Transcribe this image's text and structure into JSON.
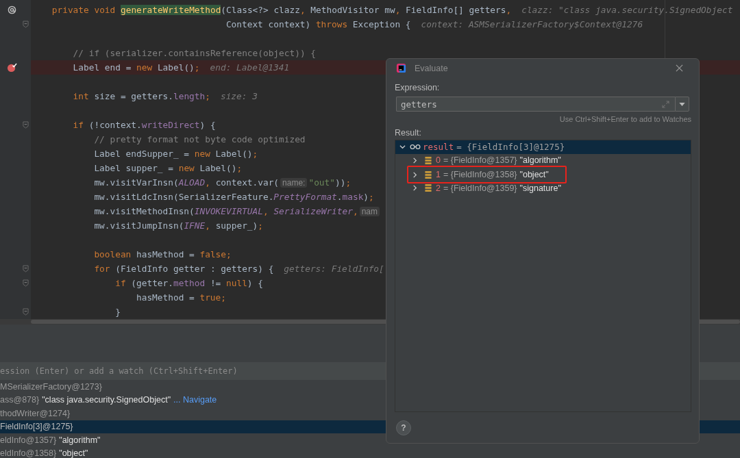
{
  "editor": {
    "lines": [
      {
        "gutter": {
          "kind": "override"
        },
        "breakpoint": false,
        "segs": [
          {
            "kind": "code",
            "tokens": [
              {
                "kind": "kw",
                "t": "    private void "
              },
              {
                "kind": "hl",
                "t": "generateWriteMethod"
              },
              {
                "kind": "id",
                "t": "(Class<?> clazz"
              },
              {
                "kind": "kw",
                "t": ", "
              },
              {
                "kind": "id",
                "t": "MethodVisitor mw"
              },
              {
                "kind": "kw",
                "t": ", "
              },
              {
                "kind": "id",
                "t": "FieldInfo[] getters"
              },
              {
                "kind": "kw",
                "t": ","
              }
            ]
          },
          {
            "kind": "hint",
            "text": "clazz: \"class java.security.SignedObject"
          }
        ]
      },
      {
        "gutter": {
          "kind": "fold"
        },
        "breakpoint": false,
        "segs": [
          {
            "kind": "code",
            "tokens": [
              {
                "kind": "id",
                "t": "                                     Context context) "
              },
              {
                "kind": "kw",
                "t": "throws"
              },
              {
                "kind": "id",
                "t": " Exception {"
              }
            ]
          },
          {
            "kind": "hint",
            "text": "context: ASMSerializerFactory$Context@1276"
          }
        ]
      },
      {
        "breakpoint": false
      },
      {
        "breakpoint": false,
        "segs": [
          {
            "kind": "code",
            "tokens": [
              {
                "kind": "cm",
                "t": "        // if (serializer.containsReference(object)) {"
              }
            ]
          }
        ]
      },
      {
        "gutter": {
          "kind": "breakpoint"
        },
        "breakpoint": true,
        "segs": [
          {
            "kind": "code",
            "tokens": [
              {
                "kind": "id",
                "t": "        Label end = "
              },
              {
                "kind": "kw",
                "t": "new"
              },
              {
                "kind": "id",
                "t": " Label()"
              },
              {
                "kind": "kw",
                "t": ";"
              }
            ]
          },
          {
            "kind": "hint",
            "text": "end: Label@1341"
          }
        ]
      },
      {
        "breakpoint": false
      },
      {
        "breakpoint": false,
        "segs": [
          {
            "kind": "code",
            "tokens": [
              {
                "kind": "kw",
                "t": "        int"
              },
              {
                "kind": "id",
                "t": " size = getters."
              },
              {
                "kind": "fd",
                "t": "length"
              },
              {
                "kind": "kw",
                "t": ";"
              }
            ]
          },
          {
            "kind": "hint",
            "text": "size: 3"
          }
        ]
      },
      {
        "breakpoint": false
      },
      {
        "gutter": {
          "kind": "fold"
        },
        "breakpoint": false,
        "segs": [
          {
            "kind": "code",
            "tokens": [
              {
                "kind": "kw",
                "t": "        if"
              },
              {
                "kind": "id",
                "t": " (!context."
              },
              {
                "kind": "fd",
                "t": "writeDirect"
              },
              {
                "kind": "id",
                "t": ") {"
              }
            ]
          }
        ]
      },
      {
        "breakpoint": false,
        "segs": [
          {
            "kind": "code",
            "tokens": [
              {
                "kind": "cm",
                "t": "            // pretty format not byte code optimized"
              }
            ]
          }
        ]
      },
      {
        "breakpoint": false,
        "segs": [
          {
            "kind": "code",
            "tokens": [
              {
                "kind": "id",
                "t": "            Label endSupper_ = "
              },
              {
                "kind": "kw",
                "t": "new"
              },
              {
                "kind": "id",
                "t": " Label()"
              },
              {
                "kind": "kw",
                "t": ";"
              }
            ]
          }
        ]
      },
      {
        "breakpoint": false,
        "segs": [
          {
            "kind": "code",
            "tokens": [
              {
                "kind": "id",
                "t": "            Label supper_ = "
              },
              {
                "kind": "kw",
                "t": "new"
              },
              {
                "kind": "id",
                "t": " Label()"
              },
              {
                "kind": "kw",
                "t": ";"
              }
            ]
          }
        ]
      },
      {
        "breakpoint": false,
        "segs": [
          {
            "kind": "code",
            "tokens": [
              {
                "kind": "id",
                "t": "            mw.visitVarInsn("
              },
              {
                "kind": "cst",
                "t": "ALOAD"
              },
              {
                "kind": "kw",
                "t": ", "
              },
              {
                "kind": "id",
                "t": "context.var("
              }
            ]
          },
          {
            "kind": "param",
            "text": "name:"
          },
          {
            "kind": "code",
            "tokens": [
              {
                "kind": "str",
                "t": "\"out\""
              },
              {
                "kind": "id",
                "t": "))"
              },
              {
                "kind": "kw",
                "t": ";"
              }
            ]
          }
        ]
      },
      {
        "breakpoint": false,
        "segs": [
          {
            "kind": "code",
            "tokens": [
              {
                "kind": "id",
                "t": "            mw.visitLdcInsn(SerializerFeature."
              },
              {
                "kind": "cst",
                "t": "PrettyFormat"
              },
              {
                "kind": "id",
                "t": "."
              },
              {
                "kind": "fd",
                "t": "mask"
              },
              {
                "kind": "id",
                "t": ")"
              },
              {
                "kind": "kw",
                "t": ";"
              }
            ]
          }
        ]
      },
      {
        "breakpoint": false,
        "segs": [
          {
            "kind": "code",
            "tokens": [
              {
                "kind": "id",
                "t": "            mw.visitMethodInsn("
              },
              {
                "kind": "cst",
                "t": "INVOKEVIRTUAL"
              },
              {
                "kind": "kw",
                "t": ", "
              },
              {
                "kind": "cst",
                "t": "SerializeWriter"
              },
              {
                "kind": "kw",
                "t": ","
              }
            ]
          },
          {
            "kind": "param",
            "text": "nam"
          }
        ]
      },
      {
        "breakpoint": false,
        "segs": [
          {
            "kind": "code",
            "tokens": [
              {
                "kind": "id",
                "t": "            mw.visitJumpInsn("
              },
              {
                "kind": "cst",
                "t": "IFNE"
              },
              {
                "kind": "kw",
                "t": ", "
              },
              {
                "kind": "id",
                "t": "supper_)"
              },
              {
                "kind": "kw",
                "t": ";"
              }
            ]
          }
        ]
      },
      {
        "breakpoint": false
      },
      {
        "breakpoint": false,
        "segs": [
          {
            "kind": "code",
            "tokens": [
              {
                "kind": "kw",
                "t": "            boolean"
              },
              {
                "kind": "id",
                "t": " hasMethod = "
              },
              {
                "kind": "kw",
                "t": "false;"
              }
            ]
          }
        ]
      },
      {
        "gutter": {
          "kind": "fold"
        },
        "breakpoint": false,
        "segs": [
          {
            "kind": "code",
            "tokens": [
              {
                "kind": "kw",
                "t": "            for"
              },
              {
                "kind": "id",
                "t": " (FieldInfo getter : getters) {"
              }
            ]
          },
          {
            "kind": "hint",
            "text": "getters: FieldInfo["
          }
        ]
      },
      {
        "gutter": {
          "kind": "fold"
        },
        "breakpoint": false,
        "segs": [
          {
            "kind": "code",
            "tokens": [
              {
                "kind": "kw",
                "t": "                if"
              },
              {
                "kind": "id",
                "t": " (getter."
              },
              {
                "kind": "fd",
                "t": "method"
              },
              {
                "kind": "id",
                "t": " != "
              },
              {
                "kind": "kw",
                "t": "null"
              },
              {
                "kind": "id",
                "t": ") {"
              }
            ]
          }
        ]
      },
      {
        "breakpoint": false,
        "segs": [
          {
            "kind": "code",
            "tokens": [
              {
                "kind": "id",
                "t": "                    hasMethod = "
              },
              {
                "kind": "kw",
                "t": "true;"
              }
            ]
          }
        ]
      },
      {
        "gutter": {
          "kind": "fold"
        },
        "breakpoint": false,
        "segs": [
          {
            "kind": "code",
            "tokens": [
              {
                "kind": "id",
                "t": "                }"
              }
            ]
          }
        ]
      }
    ]
  },
  "debugger": {
    "watch_placeholder": "ession (Enter) or add a watch (Ctrl+Shift+Enter)",
    "variables": [
      {
        "type_text": "MSerializerFactory@1273}",
        "selected": false
      },
      {
        "type_text": "ass@878}",
        "value": "\"class java.security.SignedObject\"",
        "link": "... Navigate",
        "selected": false
      },
      {
        "type_text": "thodWriter@1274}",
        "selected": false
      },
      {
        "type_text": "FieldInfo[3]@1275}",
        "selected": true
      },
      {
        "type_text": "eldInfo@1357}",
        "value": "\"algorithm\"",
        "selected": false
      },
      {
        "type_text": "eldInfo@1358}",
        "value": "\"object\"",
        "selected": false
      }
    ]
  },
  "dialog": {
    "title": "Evaluate",
    "expression_label": "Expression:",
    "expression": "getters",
    "hint": "Use Ctrl+Shift+Enter to add to Watches",
    "result_label": "Result:",
    "result": {
      "name": "result",
      "type_text": "= {FieldInfo[3]@1275}",
      "expanded": true,
      "selected": true,
      "children": [
        {
          "index": "0",
          "type_text": "= {FieldInfo@1357}",
          "value": "\"algorithm\"",
          "expanded": false,
          "highlighted": false
        },
        {
          "index": "1",
          "type_text": "= {FieldInfo@1358}",
          "value": "\"object\"",
          "expanded": false,
          "highlighted": true
        },
        {
          "index": "2",
          "type_text": "= {FieldInfo@1359}",
          "value": "\"signature\"",
          "expanded": false,
          "highlighted": false
        }
      ]
    },
    "help": "?"
  }
}
